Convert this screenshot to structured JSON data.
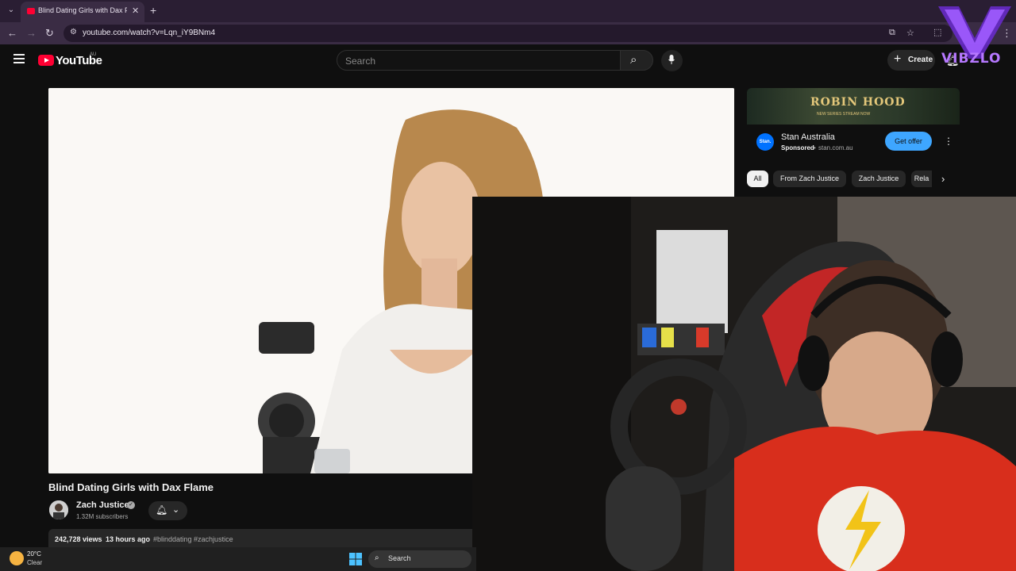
{
  "browser": {
    "tab_title": "Blind Dating Girls with Dax Flame",
    "url": "youtube.com/watch?v=Lqn_iY9BNm4"
  },
  "youtube": {
    "logo_text": "YouTube",
    "country_code": "AU",
    "search_placeholder": "Search",
    "create_label": "Create"
  },
  "watermark": {
    "text": "VIBZLO"
  },
  "video": {
    "title": "Blind Dating Girls with Dax Flame",
    "channel_name": "Zach Justice",
    "subscribers": "1.32M subscribers",
    "views": "242,728 views",
    "upload_time": "13 hours ago",
    "hashtags": "#blinddating #zachjustice"
  },
  "ad": {
    "banner_title": "ROBIN HOOD",
    "banner_sub": "NEW SERIES STREAM NOW",
    "logo_text": "Stan.",
    "advertiser": "Stan Australia",
    "sponsored": "Sponsored",
    "dot": "•",
    "domain": "stan.com.au",
    "cta": "Get offer"
  },
  "chips": [
    "All",
    "From Zach Justice",
    "Zach Justice",
    "Rela"
  ],
  "taskbar": {
    "temperature": "20°C",
    "weather": "Clear",
    "search_label": "Search"
  },
  "colors": {
    "youtube_red": "#ff0033",
    "accent_blue": "#3ea6ff",
    "watermark_purple": "#b678ff"
  }
}
